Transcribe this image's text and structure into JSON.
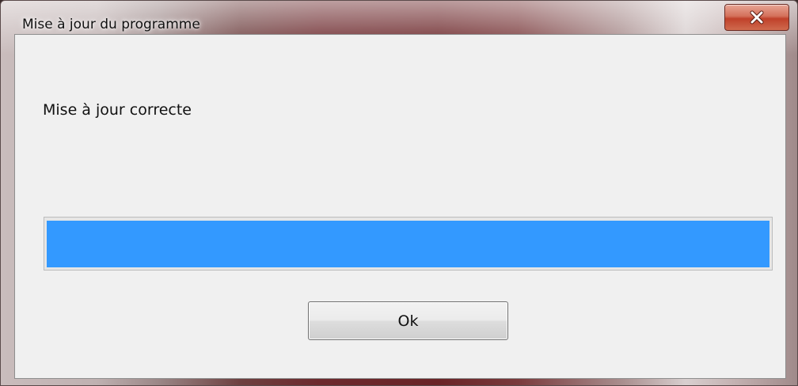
{
  "window": {
    "title": "Mise à jour du programme",
    "close_icon": "close-icon"
  },
  "dialog": {
    "message": "Mise à jour correcte",
    "progress_percent": 100,
    "progress_color": "#3399ff",
    "ok_label": "Ok"
  }
}
